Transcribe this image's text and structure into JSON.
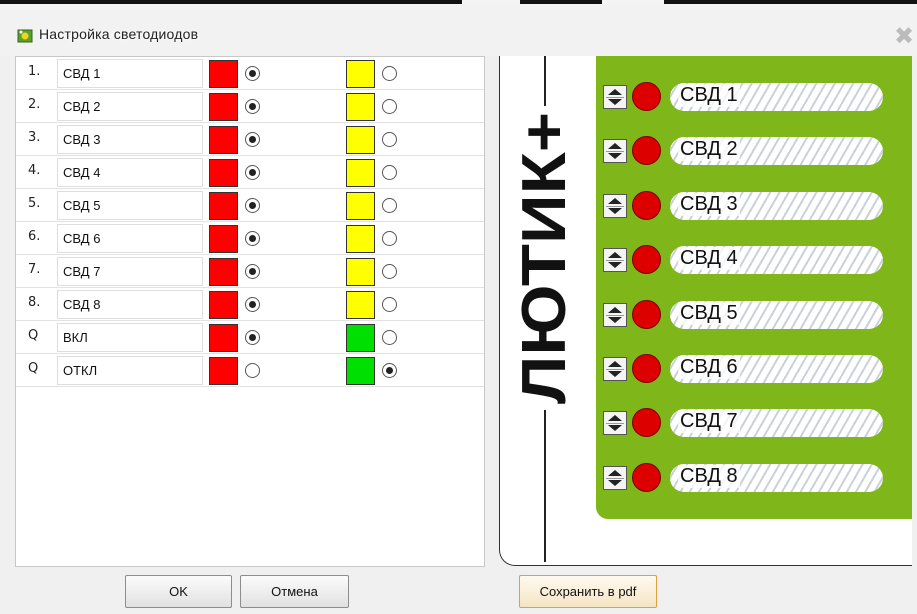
{
  "window": {
    "title": "Настройка светодиодов",
    "close_glyph": "✖"
  },
  "colors": {
    "red": "#ff0000",
    "yellow": "#ffff00",
    "green": "#00e000",
    "panel_green": "#7fb61a",
    "led_red": "#dd0000"
  },
  "rows": [
    {
      "num": "1.",
      "name": "СВД 1",
      "color1": "red",
      "color2": "yellow",
      "selected": 1
    },
    {
      "num": "2.",
      "name": "СВД 2",
      "color1": "red",
      "color2": "yellow",
      "selected": 1
    },
    {
      "num": "3.",
      "name": "СВД 3",
      "color1": "red",
      "color2": "yellow",
      "selected": 1
    },
    {
      "num": "4.",
      "name": "СВД 4",
      "color1": "red",
      "color2": "yellow",
      "selected": 1
    },
    {
      "num": "5.",
      "name": "СВД 5",
      "color1": "red",
      "color2": "yellow",
      "selected": 1
    },
    {
      "num": "6.",
      "name": "СВД 6",
      "color1": "red",
      "color2": "yellow",
      "selected": 1
    },
    {
      "num": "7.",
      "name": "СВД 7",
      "color1": "red",
      "color2": "yellow",
      "selected": 1
    },
    {
      "num": "8.",
      "name": "СВД 8",
      "color1": "red",
      "color2": "yellow",
      "selected": 1
    },
    {
      "num": "Q",
      "name": "ВКЛ",
      "color1": "red",
      "color2": "green",
      "selected": 1
    },
    {
      "num": "Q",
      "name": "ОТКЛ",
      "color1": "red",
      "color2": "green",
      "selected": 2
    }
  ],
  "buttons": {
    "ok": "OK",
    "cancel": "Отмена",
    "save_pdf": "Сохранить в pdf"
  },
  "preview": {
    "logo_text": "ЛЮТИК+",
    "leds": [
      "СВД 1",
      "СВД 2",
      "СВД 3",
      "СВД 4",
      "СВД 5",
      "СВД 6",
      "СВД 7",
      "СВД 8"
    ]
  }
}
